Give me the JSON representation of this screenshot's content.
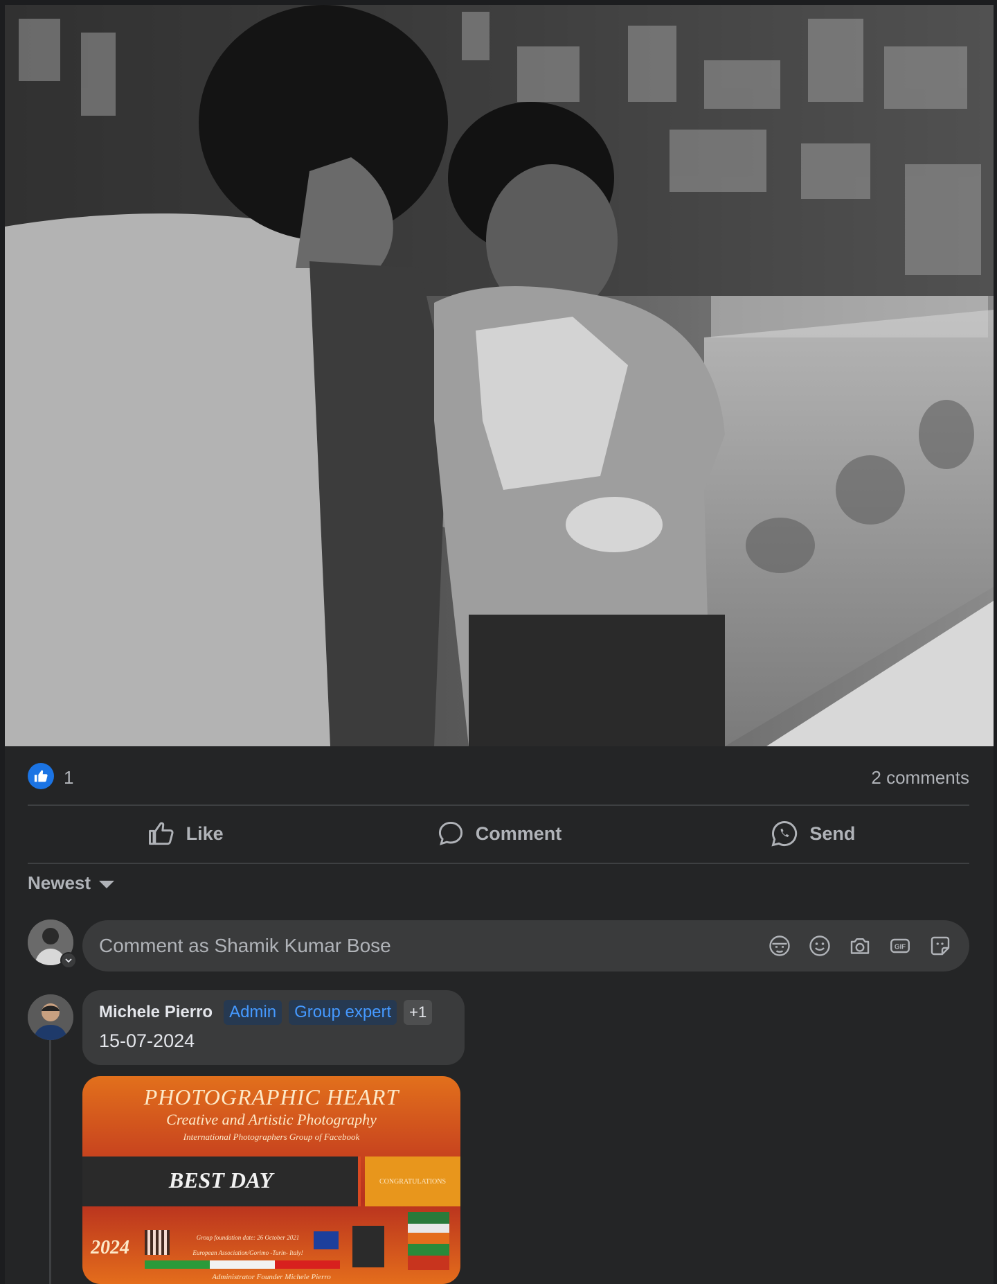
{
  "post": {
    "reactions_count": "1",
    "comments_count": "2 comments"
  },
  "actions": {
    "like_label": "Like",
    "comment_label": "Comment",
    "send_label": "Send"
  },
  "sort": {
    "label": "Newest"
  },
  "composer": {
    "placeholder": "Comment as Shamik Kumar Bose",
    "tools": [
      "avatar-sticker-icon",
      "emoji-icon",
      "camera-icon",
      "gif-icon",
      "sticker-icon"
    ]
  },
  "comment": {
    "author": "Michele Pierro",
    "badges": [
      "Admin",
      "Group expert"
    ],
    "badge_more": "+1",
    "text": "15-07-2024",
    "attachment": {
      "title": "PHOTOGRAPHIC HEART",
      "subtitle": "Creative and Artistic Photography",
      "small": "International Photographers Group of Facebook",
      "band": "BEST DAY",
      "congrats": "CONGRATULATIONS",
      "year": "2024",
      "info_line1": "Group foundation date: 26 October 2021",
      "info_line2": "European Association/Gorimo -Turin- Italy!",
      "admin": "Administrator Founder Michele Pierro"
    }
  },
  "colors": {
    "background": "#242526",
    "accent": "#1b74e4",
    "badge_blue": "#4599ff"
  }
}
